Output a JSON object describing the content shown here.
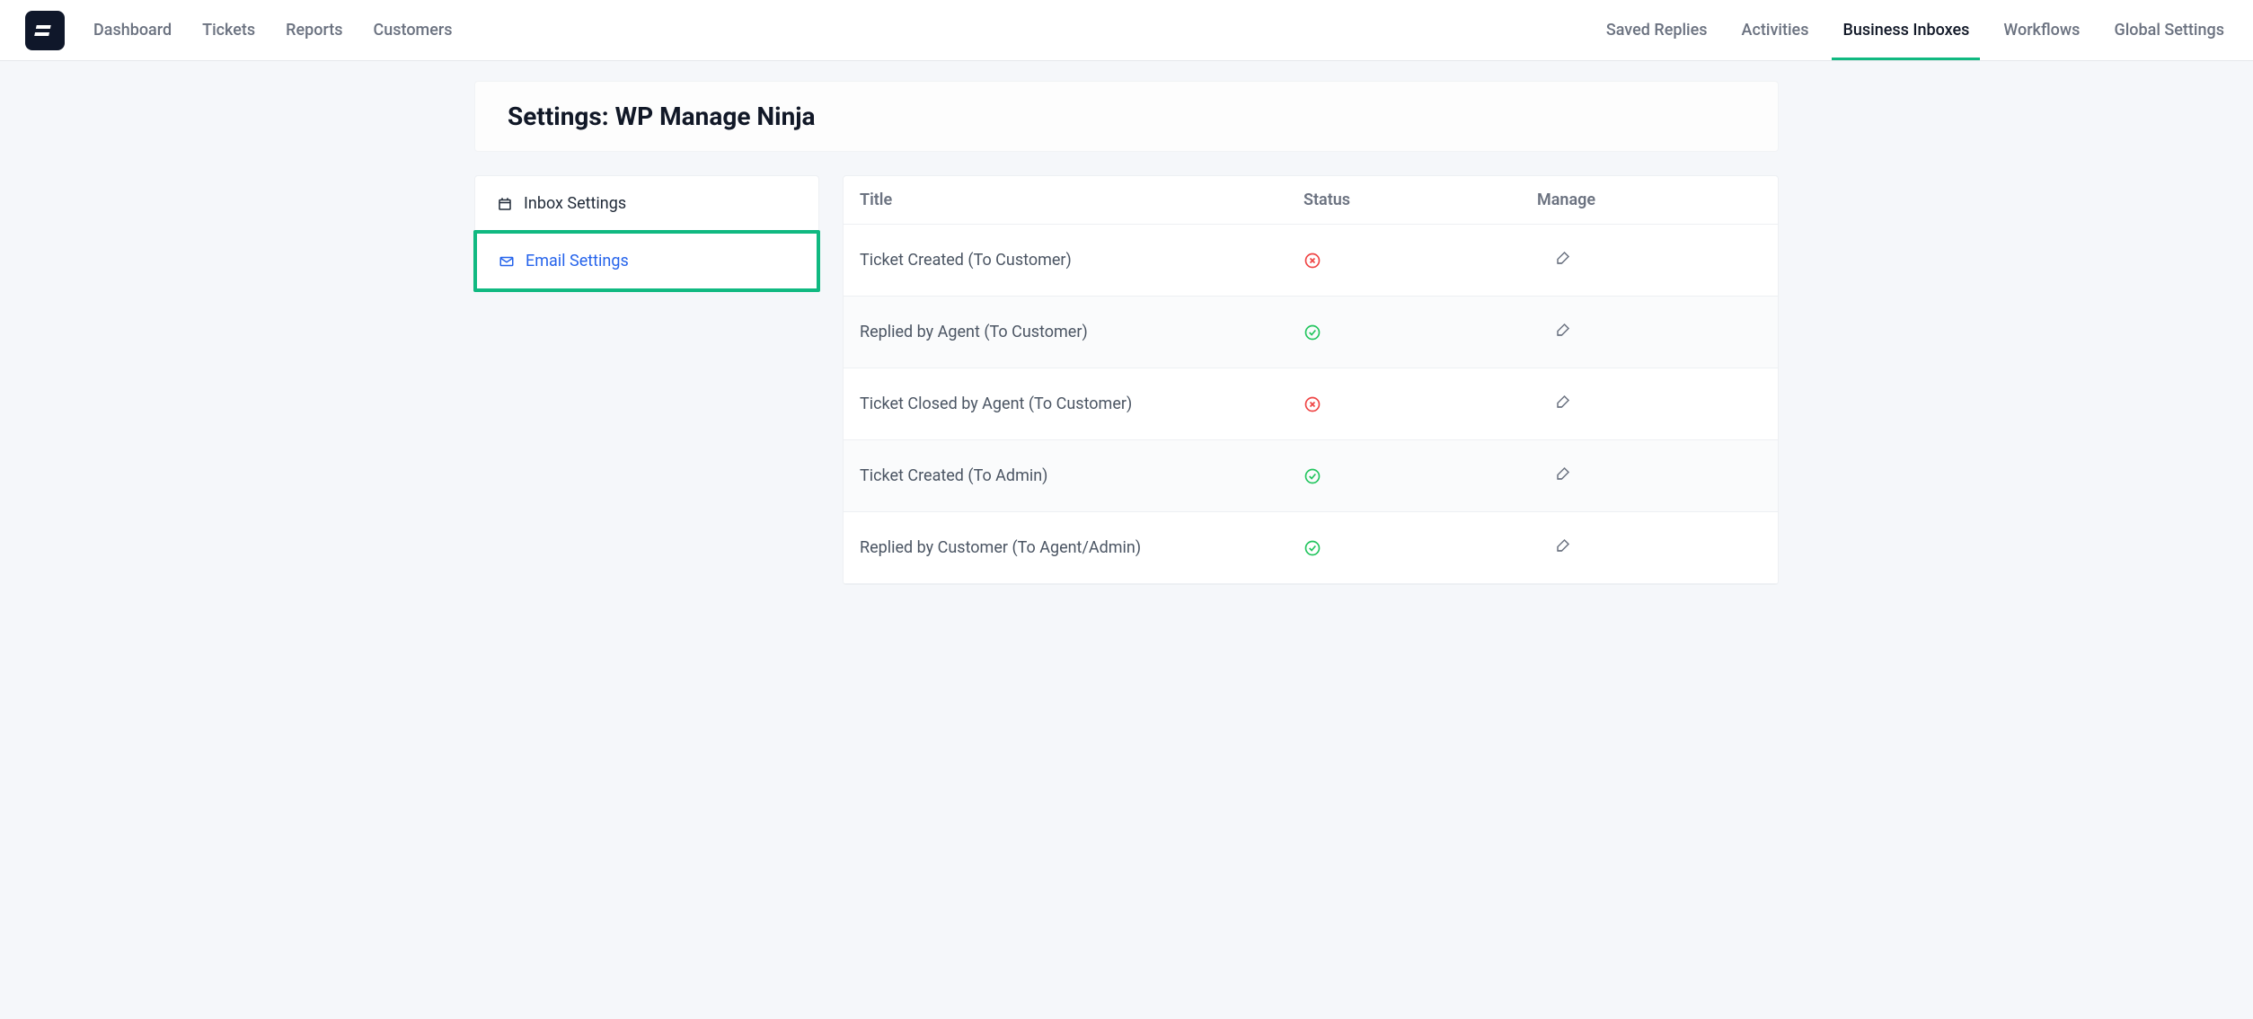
{
  "nav_left": {
    "dashboard": "Dashboard",
    "tickets": "Tickets",
    "reports": "Reports",
    "customers": "Customers"
  },
  "nav_right": {
    "saved_replies": "Saved Replies",
    "activities": "Activities",
    "business_inboxes": "Business Inboxes",
    "workflows": "Workflows",
    "global_settings": "Global Settings"
  },
  "page_title": "Settings: WP Manage Ninja",
  "sidebar": {
    "inbox_settings": "Inbox Settings",
    "email_settings": "Email Settings"
  },
  "table": {
    "headers": {
      "title": "Title",
      "status": "Status",
      "manage": "Manage"
    },
    "rows": [
      {
        "title": "Ticket Created (To Customer)",
        "status": "disabled"
      },
      {
        "title": "Replied by Agent (To Customer)",
        "status": "enabled"
      },
      {
        "title": "Ticket Closed by Agent (To Customer)",
        "status": "disabled"
      },
      {
        "title": "Ticket Created (To Admin)",
        "status": "enabled"
      },
      {
        "title": "Replied by Customer (To Agent/Admin)",
        "status": "enabled"
      }
    ]
  }
}
